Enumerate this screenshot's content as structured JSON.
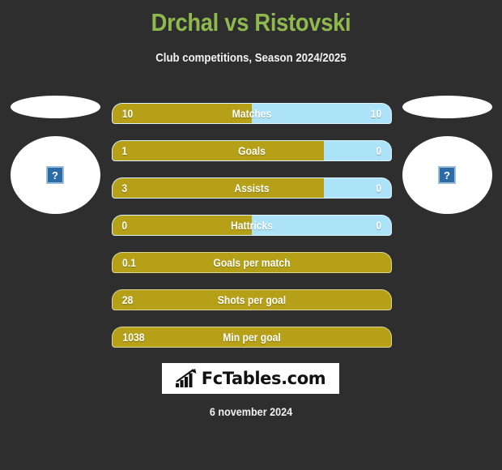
{
  "header": {
    "title": "Drchal vs Ristovski",
    "subtitle": "Club competitions, Season 2024/2025",
    "title_color": "#8fb84e"
  },
  "players": {
    "left": {
      "placeholder_icon": "broken-image-icon",
      "placeholder_glyph": "?"
    },
    "right": {
      "placeholder_icon": "broken-image-icon",
      "placeholder_glyph": "?"
    }
  },
  "colors": {
    "background": "#2e2e2e",
    "home_bar": "#b5a017",
    "away_bar": "#ade3f8",
    "title": "#8fb84e",
    "text": "#ffffff"
  },
  "footer": {
    "logo_text": "FcTables.com",
    "logo_icon": "bar-chart-arrow-icon",
    "date": "6 november 2024"
  },
  "chart_data": {
    "type": "bar",
    "title": "Drchal vs Ristovski",
    "subtitle": "Club competitions, Season 2024/2025",
    "orientation": "horizontal-diverging",
    "series": [
      {
        "name": "Drchal",
        "side": "left",
        "color": "#b5a017"
      },
      {
        "name": "Ristovski",
        "side": "right",
        "color": "#ade3f8"
      }
    ],
    "categories": [
      "Matches",
      "Goals",
      "Assists",
      "Hattricks",
      "Goals per match",
      "Shots per goal",
      "Min per goal"
    ],
    "rows": [
      {
        "label": "Matches",
        "left_value": "10",
        "right_value": "10",
        "fill_percent": 50,
        "two_sided": true
      },
      {
        "label": "Goals",
        "left_value": "1",
        "right_value": "0",
        "fill_percent": 76,
        "two_sided": true
      },
      {
        "label": "Assists",
        "left_value": "3",
        "right_value": "0",
        "fill_percent": 76,
        "two_sided": true
      },
      {
        "label": "Hattricks",
        "left_value": "0",
        "right_value": "0",
        "fill_percent": 50,
        "two_sided": true
      },
      {
        "label": "Goals per match",
        "left_value": "0.1",
        "right_value": "",
        "fill_percent": 100,
        "two_sided": false
      },
      {
        "label": "Shots per goal",
        "left_value": "28",
        "right_value": "",
        "fill_percent": 100,
        "two_sided": false
      },
      {
        "label": "Min per goal",
        "left_value": "1038",
        "right_value": "",
        "fill_percent": 100,
        "two_sided": false
      }
    ]
  }
}
